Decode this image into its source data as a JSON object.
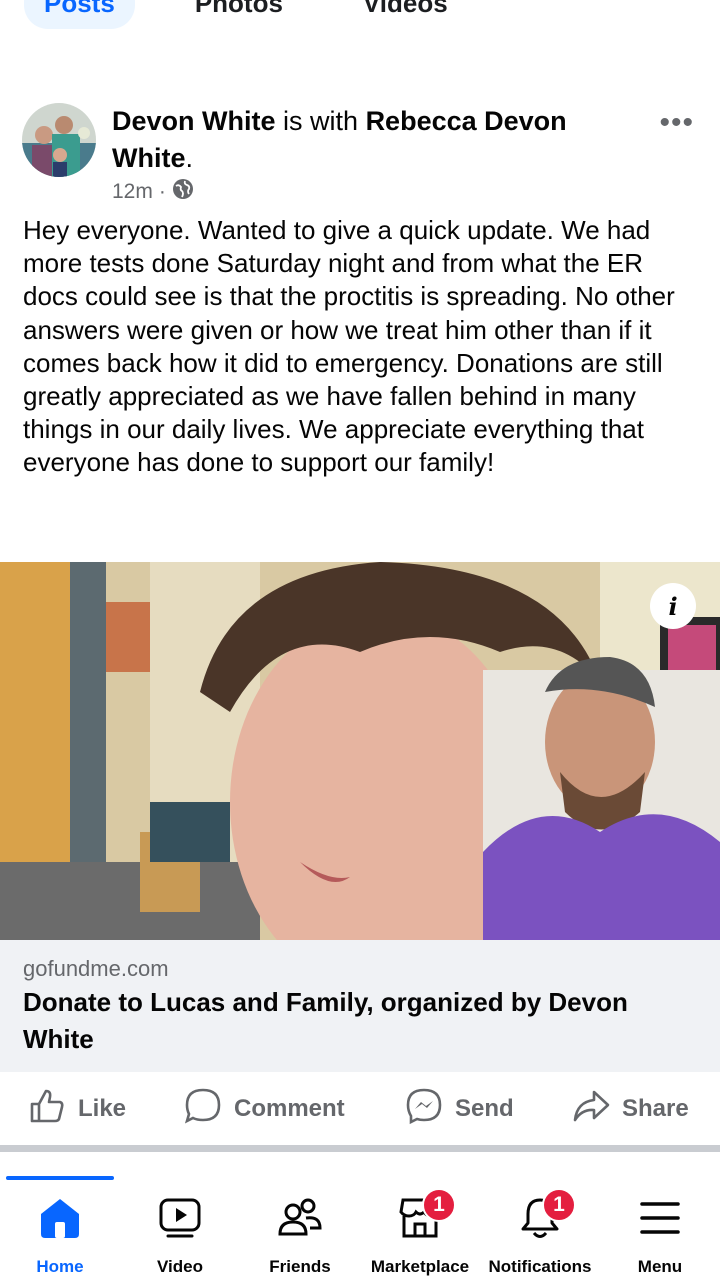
{
  "top_tabs": [
    "Posts",
    "Photos",
    "Videos"
  ],
  "post": {
    "author": "Devon White",
    "with_text": "is with",
    "tagged": "Rebecca Devon White",
    "period": ".",
    "time": "12m",
    "separator": "·",
    "privacy_icon": "globe-icon",
    "more_icon": "more-dots-icon",
    "body": "Hey everyone. Wanted to give a quick update. We had more tests done Saturday night and from what the ER docs could see is that the proctitis is spreading. No other answers were given or how we treat him other than if it comes back how it did to emergency. Donations are still greatly appreciated as we have fallen behind in many things in our daily lives. We appreciate everything that everyone has done to support our family!"
  },
  "link": {
    "info_label": "i",
    "domain": "gofundme.com",
    "title": "Donate to Lucas and Family, organized by Devon White"
  },
  "actions": {
    "like": "Like",
    "comment": "Comment",
    "send": "Send",
    "share": "Share"
  },
  "nav": {
    "home": "Home",
    "video": "Video",
    "friends": "Friends",
    "marketplace": "Marketplace",
    "marketplace_badge": "1",
    "notifications": "Notifications",
    "notifications_badge": "1",
    "menu": "Menu"
  },
  "colors": {
    "accent": "#0866ff",
    "badge": "#e41e3f",
    "muted": "#65676b"
  }
}
